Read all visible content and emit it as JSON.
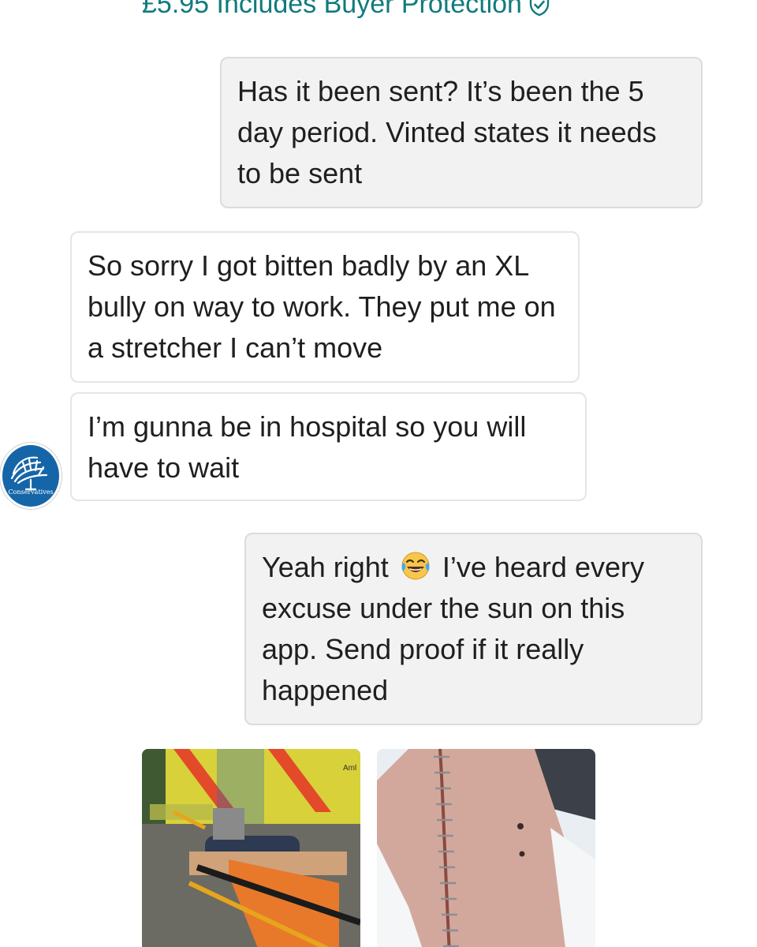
{
  "header": {
    "price_text": "£5.95 Includes Buyer Protection"
  },
  "conversation": {
    "messages": [
      {
        "sender": "me",
        "text": "Has it been sent? It’s been the 5 day period. Vinted states it needs to be sent"
      },
      {
        "sender": "seller",
        "text": "So sorry I got bitten badly by an XL bully on way to work. They put me on a stretcher I can’t move"
      },
      {
        "sender": "seller",
        "text": "I’m gunna be in hospital so you will have to wait"
      },
      {
        "sender": "me",
        "text_before_emoji": "Yeah right",
        "emoji": "face-with-tears-of-joy",
        "text_after_emoji": "I’ve heard every excuse under the sun on this app. Send proof if it really happened"
      }
    ],
    "avatar": {
      "label": "Conservatives",
      "icon": "tree-logo-icon"
    },
    "attachments": [
      {
        "name": "photo-stretcher-ambulance",
        "ambulance_text": "Aml"
      },
      {
        "name": "photo-stapled-leg-wound"
      }
    ]
  },
  "colors": {
    "accent": "#117a7c",
    "outgoing_bubble": "#f2f2f2",
    "incoming_bubble": "#ffffff",
    "avatar_bg": "#1566a8"
  }
}
